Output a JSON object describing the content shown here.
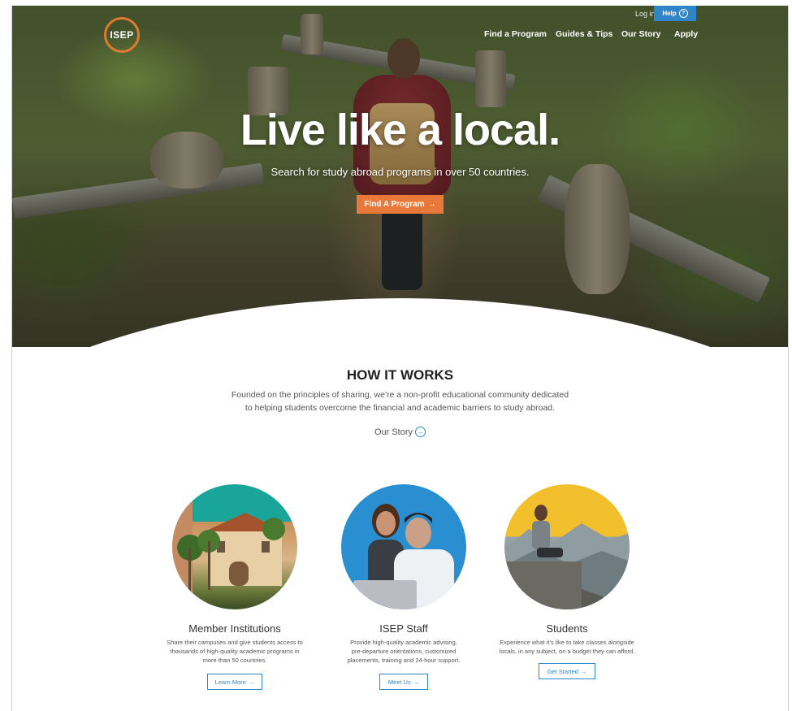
{
  "brand": {
    "logo_text": "ISEP",
    "accent": "#e8793a",
    "link_blue": "#2e86c8"
  },
  "header": {
    "login": "Log in",
    "help": "Help",
    "nav": [
      "Find a Program",
      "Guides & Tips",
      "Our Story",
      "Apply"
    ]
  },
  "hero": {
    "title": "Live like a local.",
    "subtitle": "Search for study abroad programs in over 50 countries.",
    "button": "Find A Program"
  },
  "how": {
    "title": "HOW IT WORKS",
    "description_1": "Founded on the principles of sharing, we're a non-profit educational community dedicated",
    "description_2": "to helping students overcome the financial and academic barriers to study abroad.",
    "story_link": "Our Story"
  },
  "cards": [
    {
      "title": "Member Institutions",
      "line1": "Share their campuses and give students access to",
      "line2": "thousands of high-quality academic programs in",
      "line3": "more than 50 countries.",
      "button": "Learn More"
    },
    {
      "title": "ISEP Staff",
      "line1": "Provide high-quality academic advising,",
      "line2": "pre-departure orientations, customized",
      "line3": "placements, training and 24-hour support.",
      "button": "Meet Us"
    },
    {
      "title": "Students",
      "line1": "Experience what it's like to take classes alongside",
      "line2": "locals, in any subject, on a budget they can afford.",
      "button": "Get Started"
    }
  ],
  "icons": {
    "arrow": "→",
    "help": "?",
    "circle_arrow": "→"
  }
}
